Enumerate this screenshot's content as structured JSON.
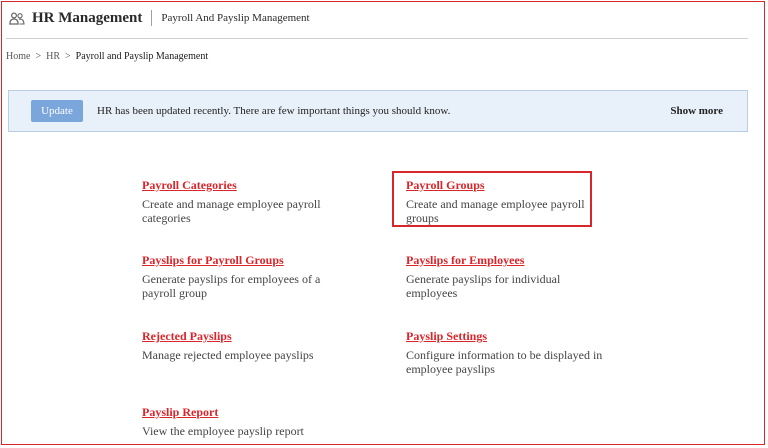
{
  "header": {
    "icon": "users-icon",
    "title": "HR Management",
    "subtitle": "Payroll And Payslip Management"
  },
  "breadcrumb": {
    "items": [
      "Home",
      "HR"
    ],
    "current": "Payroll and Payslip Management"
  },
  "banner": {
    "button_label": "Update",
    "message": "HR has been updated recently. There are few important things you should know.",
    "show_more": "Show more"
  },
  "cards": [
    {
      "title": "Payroll Categories",
      "desc": "Create and manage employee payroll categories"
    },
    {
      "title": "Payroll Groups",
      "desc": "Create and manage employee payroll groups"
    },
    {
      "title": "Payslips for Payroll Groups",
      "desc": "Generate payslips for employees of a payroll group"
    },
    {
      "title": "Payslips for Employees",
      "desc": "Generate payslips for individual employees"
    },
    {
      "title": "Rejected Payslips",
      "desc": "Manage rejected employee payslips"
    },
    {
      "title": "Payslip Settings",
      "desc": "Configure information to be displayed in employee payslips"
    },
    {
      "title": "Payslip Report",
      "desc": "View the employee payslip report"
    }
  ],
  "colors": {
    "accent": "#d9262b",
    "banner_bg": "#e8f0fa",
    "button": "#7aa6dc"
  }
}
